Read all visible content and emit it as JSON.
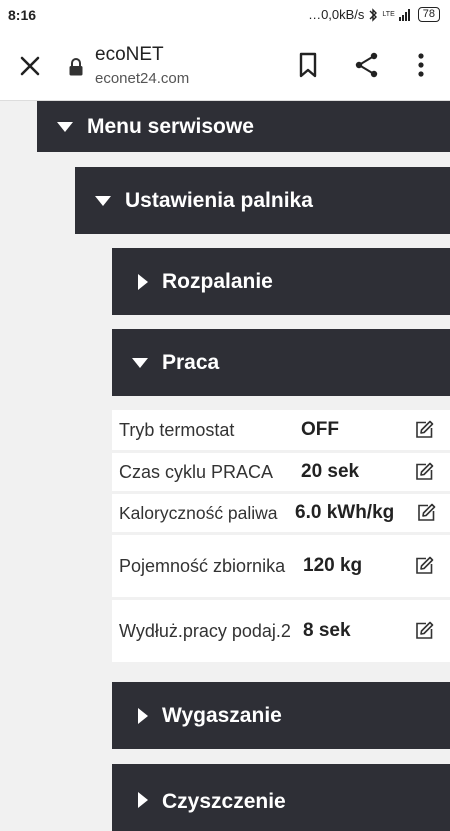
{
  "status_bar": {
    "time": "8:16",
    "network": "…0,0kB/s",
    "bluetooth_icon": "bluetooth-icon",
    "lte": "LTE",
    "battery": "78"
  },
  "browser": {
    "title": "ecoNET",
    "url": "econet24.com"
  },
  "menu": {
    "service_menu": "Menu serwisowe",
    "burner_settings": "Ustawienia palnika",
    "ignition": "Rozpalanie",
    "work": "Praca",
    "extinguishing": "Wygaszanie",
    "cleaning": "Czyszczenie"
  },
  "work_params": [
    {
      "name": "Tryb termostat",
      "value": "OFF"
    },
    {
      "name": "Czas cyklu PRACA",
      "value": "20 sek"
    },
    {
      "name": "Kaloryczność paliwa",
      "value": "6.0 kWh/kg"
    },
    {
      "name": "Pojemność zbiornika",
      "value": "120 kg"
    },
    {
      "name": "Wydłuż.pracy podaj.2",
      "value": "8 sek"
    }
  ],
  "colors": {
    "panel": "#2e2f36",
    "background": "#f1f1f1"
  }
}
